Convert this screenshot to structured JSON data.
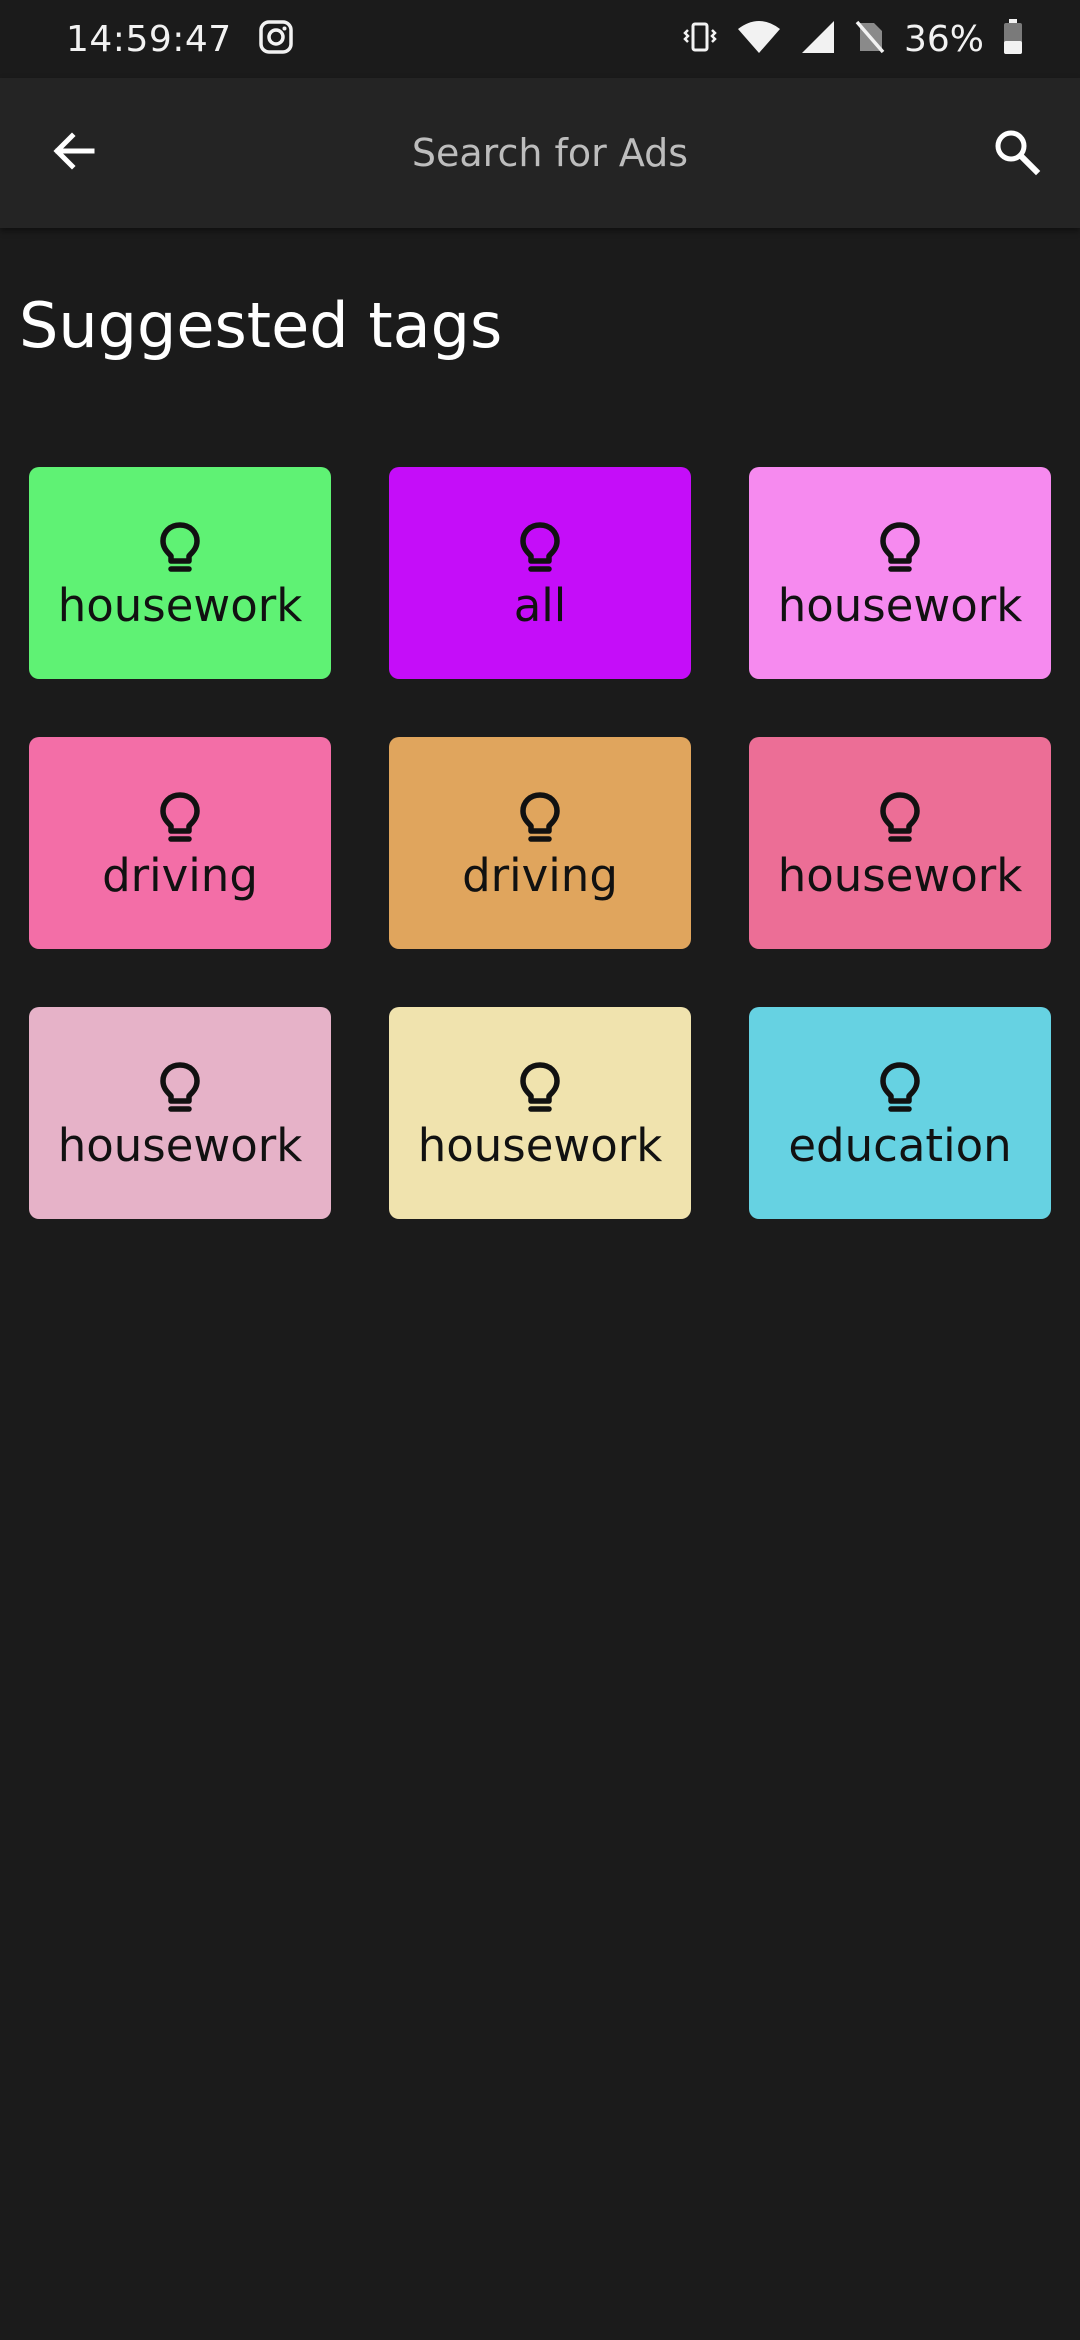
{
  "status_bar": {
    "time": "14:59:47",
    "battery": "36%",
    "icons": [
      "instagram-icon",
      "vibrate-icon",
      "wifi-icon",
      "signal-icon",
      "no-sim-icon",
      "battery-icon"
    ]
  },
  "app_bar": {
    "back_icon": "arrow-left-icon",
    "search_placeholder": "Search for Ads",
    "search_icon": "search-icon"
  },
  "section": {
    "title": "Suggested tags"
  },
  "tags": [
    {
      "label": "housework",
      "color": "#5ff274",
      "icon": "lightbulb-icon"
    },
    {
      "label": "all",
      "color": "#c50df9",
      "icon": "lightbulb-icon"
    },
    {
      "label": "housework",
      "color": "#f68aef",
      "icon": "lightbulb-icon"
    },
    {
      "label": "driving",
      "color": "#f36ea7",
      "icon": "lightbulb-icon"
    },
    {
      "label": "driving",
      "color": "#e0a55d",
      "icon": "lightbulb-icon"
    },
    {
      "label": "housework",
      "color": "#ec6e96",
      "icon": "lightbulb-icon"
    },
    {
      "label": "housework",
      "color": "#e6b2c8",
      "icon": "lightbulb-icon"
    },
    {
      "label": "housework",
      "color": "#f0e3ae",
      "icon": "lightbulb-icon"
    },
    {
      "label": "education",
      "color": "#66d2e2",
      "icon": "lightbulb-icon"
    }
  ]
}
